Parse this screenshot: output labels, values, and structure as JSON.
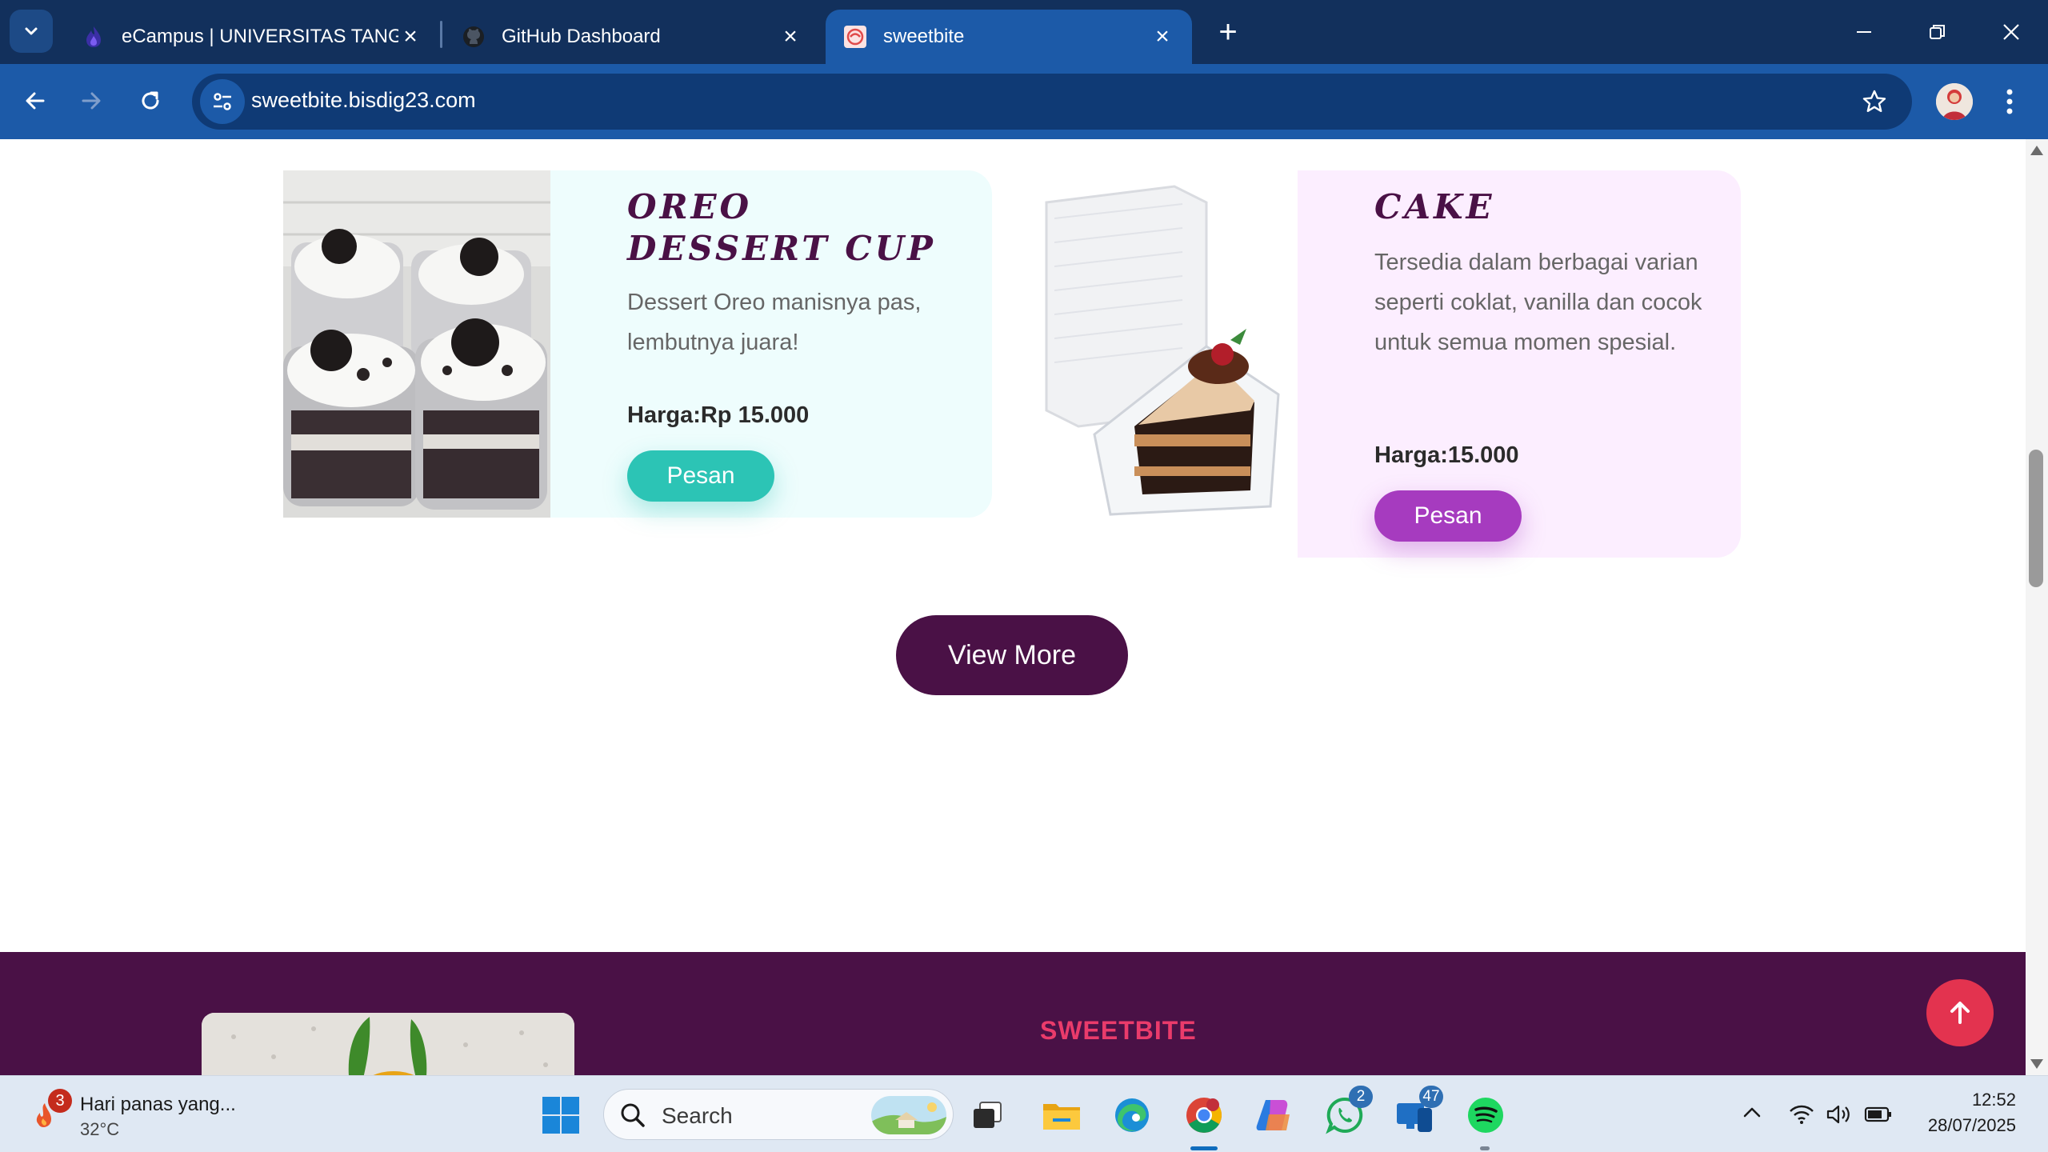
{
  "browser": {
    "tabs": [
      {
        "title": "eCampus | UNIVERSITAS TANGERANG",
        "favicon": "flame-icon"
      },
      {
        "title": "GitHub Dashboard",
        "favicon": "github-icon"
      },
      {
        "title": "sweetbite",
        "favicon": "sweetbite-icon",
        "active": true
      }
    ],
    "url": "sweetbite.bisdig23.com",
    "colors": {
      "frame": "#12305c",
      "toolbar": "#1c5aa8",
      "omnibox": "#0f3a75"
    }
  },
  "products": [
    {
      "title": "OREO DESSERT CUP",
      "description": "Dessert Oreo manisnya pas, lembutnya juara!",
      "price": "Harga:Rp 15.000",
      "button": "Pesan",
      "card_color": "#eefdfd",
      "button_color": "#2cc4b5"
    },
    {
      "title": "CAKE",
      "description": "Tersedia dalam berbagai varian seperti coklat, vanilla dan cocok untuk semua momen spesial.",
      "price": "Harga:15.000",
      "button": "Pesan",
      "card_color": "#fceeff",
      "button_color": "#a63bbf"
    }
  ],
  "view_more": "View More",
  "footer": {
    "brand": "SWEETBITE",
    "background": "#4a1146",
    "brand_color": "#ea3b6b"
  },
  "taskbar": {
    "weather": {
      "text": "Hari panas yang...",
      "temp": "32°C",
      "badge": "3"
    },
    "search_placeholder": "Search",
    "apps": [
      {
        "name": "task-view"
      },
      {
        "name": "file-explorer"
      },
      {
        "name": "edge"
      },
      {
        "name": "chrome",
        "active": true
      },
      {
        "name": "copilot"
      },
      {
        "name": "whatsapp",
        "badge": "2"
      },
      {
        "name": "phone-link",
        "badge": "47"
      },
      {
        "name": "spotify"
      }
    ],
    "time": "12:52",
    "date": "28/07/2025"
  }
}
